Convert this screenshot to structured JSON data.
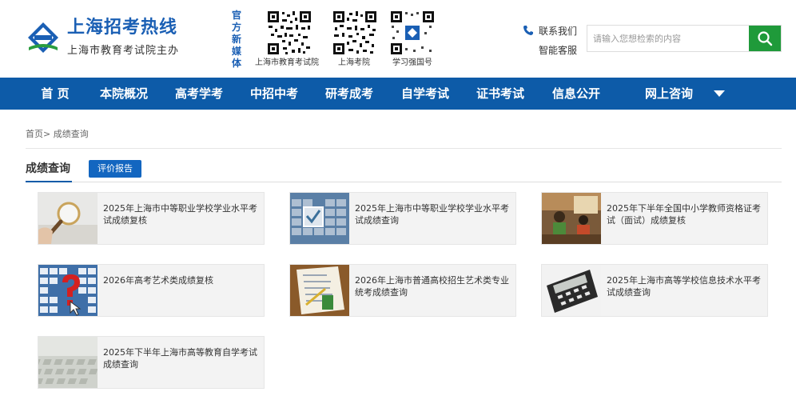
{
  "header": {
    "logo_title": "上海招考热线",
    "logo_sub": "上海市教育考试院主办",
    "media_label": "官方新媒体",
    "qr_codes": [
      {
        "caption": "上海市教育考试院"
      },
      {
        "caption": "上海考院"
      },
      {
        "caption": "学习强国号"
      }
    ],
    "contact_label": "联系我们",
    "service_label": "智能客服",
    "search_placeholder": "请输入您想检索的内容"
  },
  "nav": {
    "items": [
      "首 页",
      "本院概况",
      "高考学考",
      "中招中考",
      "研考成考",
      "自学考试",
      "证书考试",
      "信息公开",
      "网上咨询"
    ]
  },
  "breadcrumb": {
    "home": "首页",
    "separator": ">",
    "current": "成绩查询"
  },
  "tabs": {
    "active": "成绩查询",
    "other": "评价报告"
  },
  "cards": [
    {
      "title": "2025年上海市中等职业学校学业水平考试成绩复核",
      "image": "magnifier"
    },
    {
      "title": "2025年上海市中等职业学校学业水平考试成绩查询",
      "image": "keyboard-check"
    },
    {
      "title": "2025年下半年全国中小学教师资格证考试（面试）成绩复核",
      "image": "classroom"
    },
    {
      "title": "2026年高考艺术类成绩复核",
      "image": "keyboard-question"
    },
    {
      "title": "2026年上海市普通高校招生艺术类专业统考成绩查询",
      "image": "answer-sheet"
    },
    {
      "title": "2025年上海市高等学校信息技术水平考试成绩查询",
      "image": "calculator"
    },
    {
      "title": "2025年下半年上海市高等教育自学考试成绩查询",
      "image": "keyboard-gray"
    }
  ],
  "colors": {
    "brand_blue": "#0d5ba8",
    "search_green": "#1f9a3a",
    "tab_button": "#1366c0"
  }
}
